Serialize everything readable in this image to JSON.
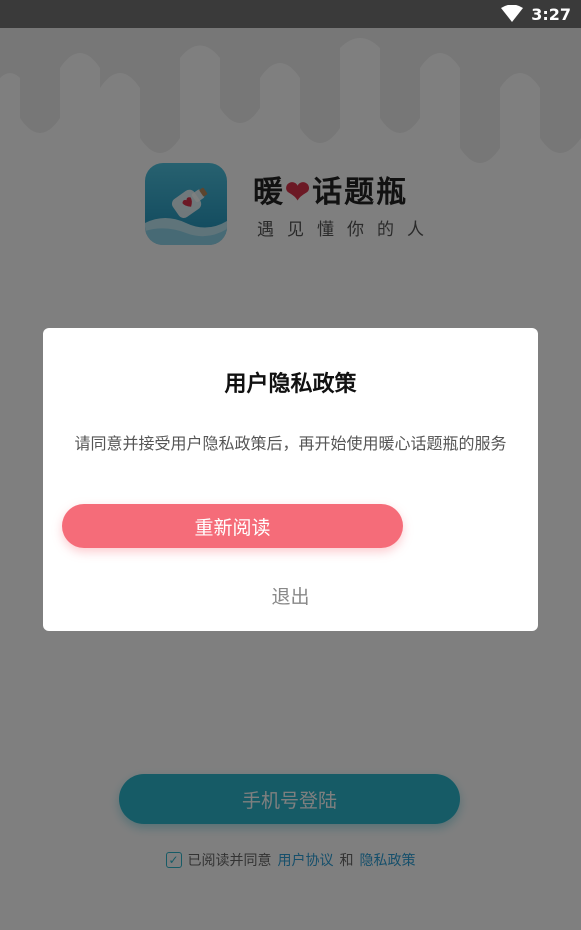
{
  "status_bar": {
    "time": "3:27",
    "wifi_icon": "wifi-icon"
  },
  "brand": {
    "title_part1": "暖",
    "title_heart": "❤",
    "title_part2": "话题瓶",
    "slogan": "遇见懂你的人",
    "icon": "message-bottle-icon"
  },
  "login": {
    "phone_login_label": "手机号登陆"
  },
  "agreement": {
    "prefix": "已阅读并同意",
    "user_agreement": "用户协议",
    "and": "和",
    "privacy_policy": "隐私政策"
  },
  "dialog": {
    "title": "用户隐私政策",
    "message": "请同意并接受用户隐私政策后，再开始使用暖心话题瓶的服务",
    "reread_label": "重新阅读",
    "exit_label": "退出"
  },
  "colors": {
    "accent_teal": "#2db6cc",
    "button_pink": "#f56c79",
    "link_blue": "#2d9fd6"
  }
}
